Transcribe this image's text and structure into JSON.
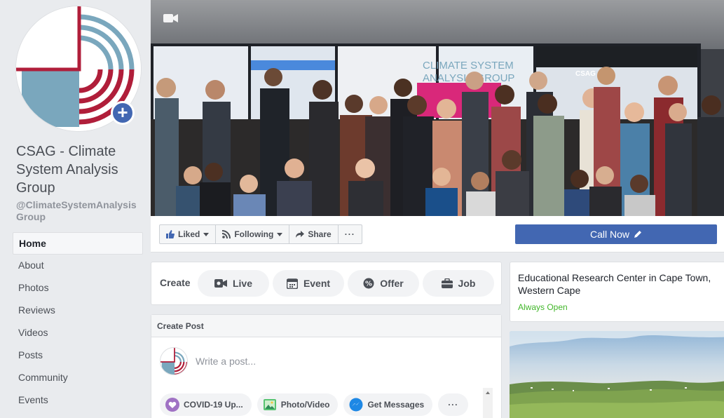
{
  "page": {
    "name": "CSAG - Climate System Analysis Group",
    "handle": "@ClimateSystemAnalysisGroup"
  },
  "sidebar": {
    "items": [
      {
        "label": "Home",
        "active": true
      },
      {
        "label": "About"
      },
      {
        "label": "Photos"
      },
      {
        "label": "Reviews"
      },
      {
        "label": "Videos"
      },
      {
        "label": "Posts"
      },
      {
        "label": "Community"
      },
      {
        "label": "Events"
      }
    ]
  },
  "cover": {
    "screen_text_1": "CLIMATE SYSTEM",
    "screen_text_2": "ANALYSIS GROUP",
    "screen_brand": "CSAG",
    "camera_icon": "video-camera-icon"
  },
  "actions": {
    "liked": "Liked",
    "following": "Following",
    "share": "Share",
    "more": "···",
    "call_now": "Call Now"
  },
  "create": {
    "label": "Create",
    "live": "Live",
    "event": "Event",
    "offer": "Offer",
    "job": "Job"
  },
  "post": {
    "header": "Create Post",
    "placeholder": "Write a post...",
    "covid": "COVID-19 Up...",
    "photo_video": "Photo/Video",
    "get_messages": "Get Messages",
    "more": "···"
  },
  "info": {
    "title": "Educational Research Center in Cape Town, Western Cape",
    "status": "Always Open"
  },
  "colors": {
    "brand_blue": "#4267b2",
    "logo_red": "#b01e3a",
    "logo_blue": "#7aa7bd",
    "status_green": "#42b72a"
  }
}
